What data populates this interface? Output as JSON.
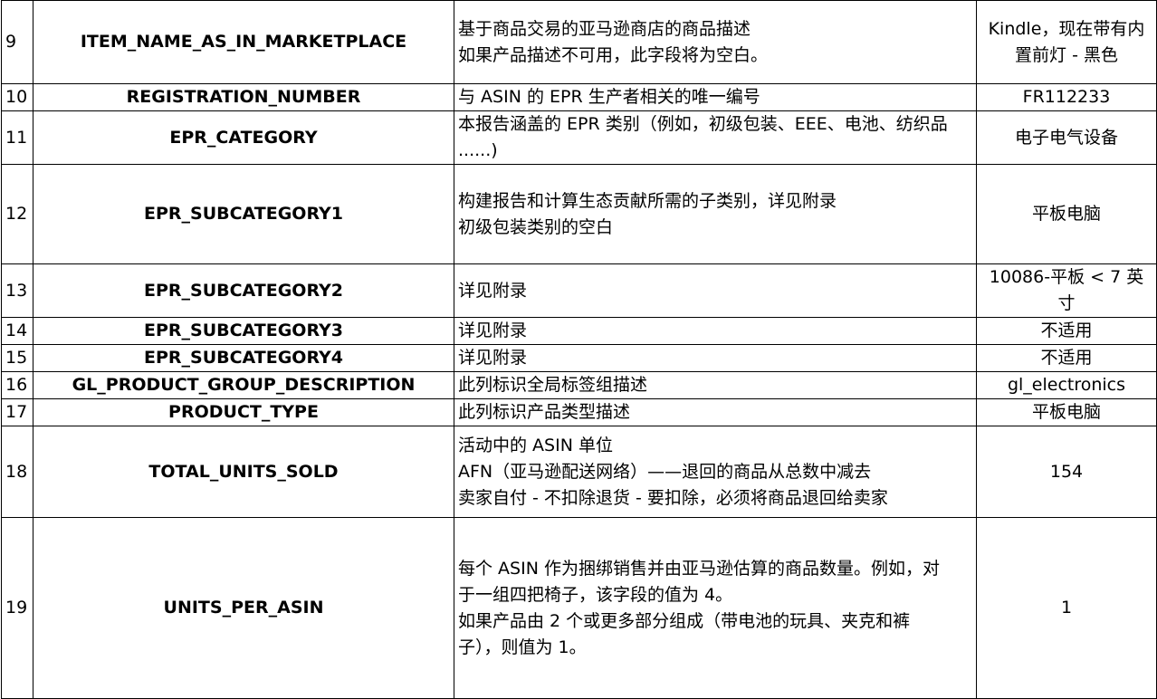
{
  "rows": [
    {
      "no": "9",
      "field": "ITEM_NAME_AS_IN_MARKETPLACE",
      "desc": [
        "基于商品交易的亚马逊商店的商品描述",
        "如果产品描述不可用，此字段将为空白。"
      ],
      "example": [
        "Kindle，现在带有内",
        "置前灯 - 黑色"
      ]
    },
    {
      "no": "10",
      "field": "REGISTRATION_NUMBER",
      "desc": [
        "与 ASIN 的 EPR 生产者相关的唯一编号"
      ],
      "example": [
        "FR112233"
      ]
    },
    {
      "no": "11",
      "field": "EPR_CATEGORY",
      "desc": [
        "本报告涵盖的 EPR 类别（例如，初级包装、EEE、电池、纺织品",
        "......)"
      ],
      "example": [
        "电子电气设备"
      ]
    },
    {
      "no": "12",
      "field": "EPR_SUBCATEGORY1",
      "desc": [
        "构建报告和计算生态贡献所需的子类别，详见附录",
        "初级包装类别的空白"
      ],
      "example": [
        "平板电脑"
      ]
    },
    {
      "no": "13",
      "field": "EPR_SUBCATEGORY2",
      "desc": [
        "详见附录"
      ],
      "example": [
        "10086-平板 < 7 英",
        "寸"
      ]
    },
    {
      "no": "14",
      "field": "EPR_SUBCATEGORY3",
      "desc": [
        "详见附录"
      ],
      "example": [
        "不适用"
      ]
    },
    {
      "no": "15",
      "field": "EPR_SUBCATEGORY4",
      "desc": [
        "详见附录"
      ],
      "example": [
        "不适用"
      ]
    },
    {
      "no": "16",
      "field": "GL_PRODUCT_GROUP_DESCRIPTION",
      "desc": [
        "此列标识全局标签组描述"
      ],
      "example": [
        "gl_electronics"
      ]
    },
    {
      "no": "17",
      "field": "PRODUCT_TYPE",
      "desc": [
        "此列标识产品类型描述"
      ],
      "example": [
        "平板电脑"
      ]
    },
    {
      "no": "18",
      "field": "TOTAL_UNITS_SOLD",
      "desc": [
        "活动中的 ASIN 单位",
        "AFN（亚马逊配送网络）——退回的商品从总数中减去",
        "卖家自付 - 不扣除退货 - 要扣除，必须将商品退回给卖家"
      ],
      "example": [
        "154"
      ]
    },
    {
      "no": "19",
      "field": "UNITS_PER_ASIN",
      "desc": [
        "每个 ASIN 作为捆绑销售并由亚马逊估算的商品数量。例如，对",
        "于一组四把椅子，该字段的值为 4。",
        "如果产品由 2 个或更多部分组成（带电池的玩具、夹克和裤",
        "子），则值为 1。"
      ],
      "example": [
        "1"
      ]
    }
  ]
}
